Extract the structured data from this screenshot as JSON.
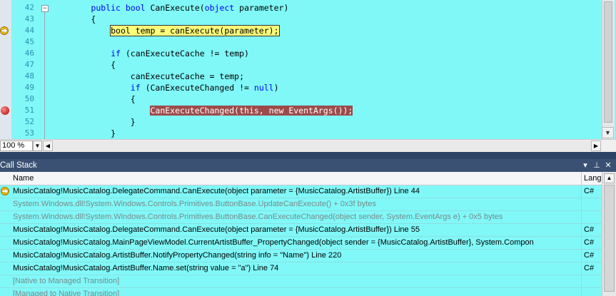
{
  "editor": {
    "line_numbers": [
      "42",
      "43",
      "44",
      "45",
      "46",
      "47",
      "48",
      "49",
      "50",
      "51",
      "52",
      "53"
    ],
    "lines": [
      [
        {
          "t": "        "
        },
        {
          "t": "public",
          "c": "kw"
        },
        {
          "t": " "
        },
        {
          "t": "bool",
          "c": "kw"
        },
        {
          "t": " CanExecute("
        },
        {
          "t": "object",
          "c": "kw"
        },
        {
          "t": " parameter)"
        }
      ],
      [
        {
          "t": "        {"
        }
      ],
      [
        {
          "t": "            "
        },
        {
          "t": "bool temp = canExecute(parameter);",
          "c": "cur"
        }
      ],
      [
        {
          "t": ""
        }
      ],
      [
        {
          "t": "            "
        },
        {
          "t": "if",
          "c": "kw"
        },
        {
          "t": " (canExecuteCache != temp)"
        }
      ],
      [
        {
          "t": "            {"
        }
      ],
      [
        {
          "t": "                canExecuteCache = temp;"
        }
      ],
      [
        {
          "t": "                "
        },
        {
          "t": "if",
          "c": "kw"
        },
        {
          "t": " (CanExecuteChanged != "
        },
        {
          "t": "null",
          "c": "kw"
        },
        {
          "t": ")"
        }
      ],
      [
        {
          "t": "                {"
        }
      ],
      [
        {
          "t": "                    "
        },
        {
          "t": "CanExecuteChanged(this, new EventArgs());",
          "c": "bp"
        }
      ],
      [
        {
          "t": "                }"
        }
      ],
      [
        {
          "t": "            }"
        }
      ]
    ],
    "collapse_glyph": "−",
    "current_line_icon": "current-statement-arrow-icon",
    "breakpoint_icon": "breakpoint-icon",
    "zoom": "100 %"
  },
  "callstack": {
    "title": "Call Stack",
    "columns": {
      "name": "Name",
      "language": "Langu"
    },
    "rows": [
      {
        "name": "MusicCatalog!MusicCatalog.DelegateCommand.CanExecute(object parameter = {MusicCatalog.ArtistBuffer}) Line 44",
        "lang": "C#",
        "dim": false,
        "current": true
      },
      {
        "name": "System.Windows.dll!System.Windows.Controls.Primitives.ButtonBase.UpdateCanExecute() + 0x3f bytes",
        "lang": "",
        "dim": true,
        "current": false
      },
      {
        "name": "System.Windows.dll!System.Windows.Controls.Primitives.ButtonBase.CanExecuteChanged(object sender, System.EventArgs e) + 0x5 bytes",
        "lang": "",
        "dim": true,
        "current": false
      },
      {
        "name": "MusicCatalog!MusicCatalog.DelegateCommand.CanExecute(object parameter = {MusicCatalog.ArtistBuffer}) Line 55",
        "lang": "C#",
        "dim": false,
        "current": false
      },
      {
        "name": "MusicCatalog!MusicCatalog.MainPageViewModel.CurrentArtistBuffer_PropertyChanged(object sender = {MusicCatalog.ArtistBuffer}, System.Compon",
        "lang": "C#",
        "dim": false,
        "current": false
      },
      {
        "name": "MusicCatalog!MusicCatalog.ArtistBuffer.NotifyPropertyChanged(string info = \"Name\") Line 220",
        "lang": "C#",
        "dim": false,
        "current": false
      },
      {
        "name": "MusicCatalog!MusicCatalog.ArtistBuffer.Name.set(string value = \"a\") Line 74",
        "lang": "C#",
        "dim": false,
        "current": false
      },
      {
        "name": "[Native to Managed Transition]",
        "lang": "",
        "dim": true,
        "current": false
      },
      {
        "name": "[Managed to Native Transition]",
        "lang": "",
        "dim": true,
        "current": false
      }
    ],
    "title_buttons": [
      "▾",
      "⊥",
      "✕"
    ]
  },
  "colors": {
    "editor_bg": "#80f8f8",
    "keyword": "#0000ff",
    "current_statement": "#fdff7a",
    "breakpoint_highlight": "#9c4b4b",
    "toolwindow_title": "#3a5174"
  }
}
